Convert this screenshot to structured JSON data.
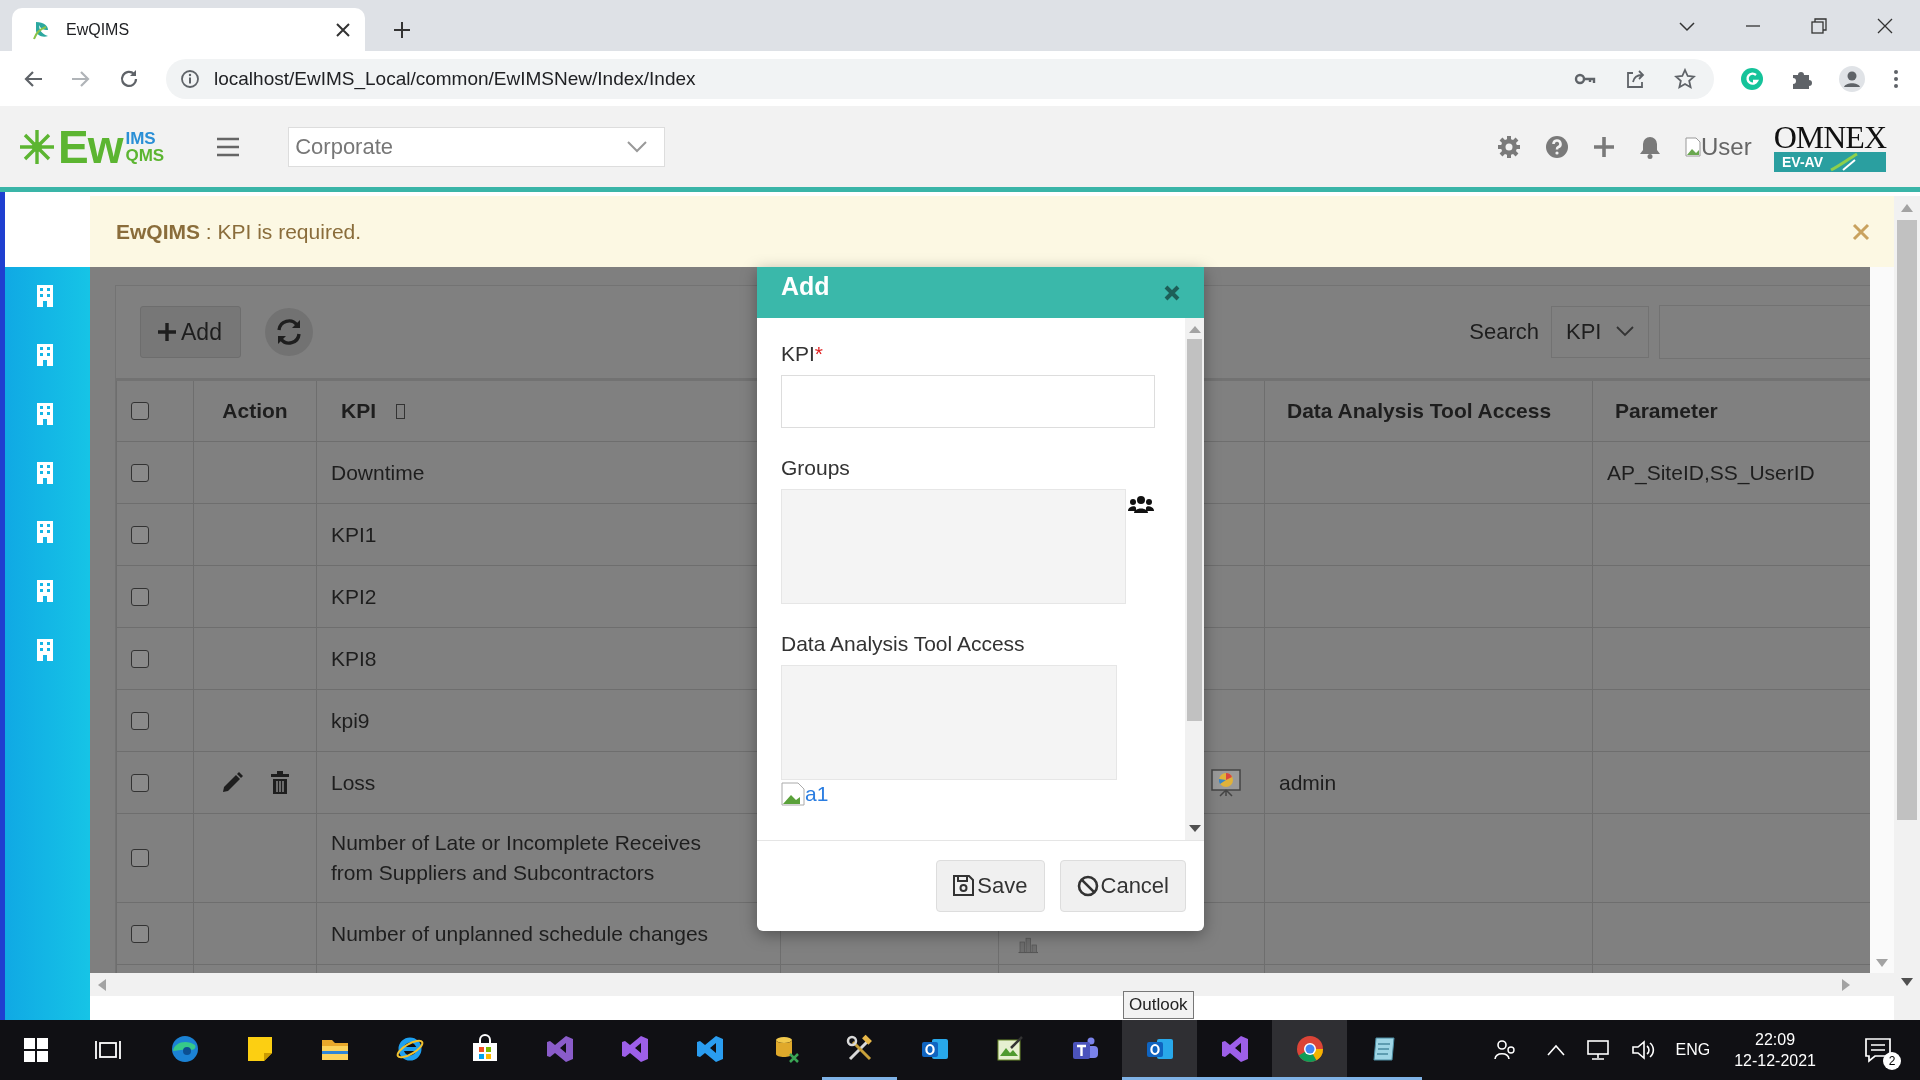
{
  "browser": {
    "tab_title": "EwQIMS",
    "url": "localhost/EwIMS_Local/common/EwIMSNew/Index/Index"
  },
  "header": {
    "logo_main": "Ew",
    "logo_top": "IMS",
    "logo_bottom": "QMS",
    "site": "Corporate",
    "user_alt": "User",
    "brand": "OMNEX",
    "brand_tag": "EV-AV"
  },
  "sidebar": {
    "items": [
      {
        "kind": "building"
      },
      {
        "kind": "building"
      },
      {
        "kind": "building"
      },
      {
        "kind": "building"
      },
      {
        "kind": "building"
      },
      {
        "kind": "building"
      },
      {
        "kind": "building"
      }
    ]
  },
  "alert": {
    "message": "**EwQIMS** : KPI is required."
  },
  "toolbar": {
    "add_label": "Add",
    "search_label": "Search",
    "search_by": "KPI"
  },
  "table": {
    "header_checked": false,
    "columns": [
      "Action",
      "KPI",
      "Data Analysis Tool Access",
      "Parameter"
    ],
    "rows": [
      {
        "checked": false,
        "editable": false,
        "kpi": "Downtime",
        "parameter": "AP_SiteID,SS_UserID"
      },
      {
        "checked": false,
        "editable": false,
        "kpi": "KPI1"
      },
      {
        "checked": false,
        "editable": false,
        "kpi": "KPI2"
      },
      {
        "checked": false,
        "editable": false,
        "kpi": "KPI8"
      },
      {
        "checked": false,
        "editable": false,
        "kpi": "kpi9"
      },
      {
        "checked": false,
        "editable": true,
        "kpi": "Loss",
        "kind": "presentation",
        "data_analysis": "admin"
      },
      {
        "checked": false,
        "editable": false,
        "kpi": "Number of Late or Incomplete Receives from Suppliers and Subcontractors"
      },
      {
        "checked": false,
        "editable": false,
        "kpi": "Number of unplanned schedule changes",
        "kind": "bars"
      }
    ]
  },
  "dialog": {
    "title": "Add",
    "fields": [
      {
        "kind": "text",
        "label": "KPI",
        "required_mark": "*"
      },
      {
        "kind": "picker",
        "label": "Groups"
      },
      {
        "kind": "list",
        "label": "Data Analysis Tool Access"
      }
    ],
    "image_alt": "a1",
    "buttons": [
      {
        "kind": "save",
        "label": "Save"
      },
      {
        "kind": "cancel",
        "label": "Cancel"
      }
    ]
  },
  "taskbar": {
    "apps": [
      {
        "kind": "edge",
        "running": false,
        "highlighted": false
      },
      {
        "kind": "notes",
        "running": false,
        "highlighted": false
      },
      {
        "kind": "explorer",
        "running": false,
        "highlighted": false
      },
      {
        "kind": "ie",
        "running": false,
        "highlighted": false
      },
      {
        "kind": "store",
        "running": false,
        "highlighted": false
      },
      {
        "kind": "vsold",
        "running": false,
        "highlighted": false
      },
      {
        "kind": "vs",
        "running": false,
        "highlighted": false
      },
      {
        "kind": "vscode",
        "running": false,
        "highlighted": false
      },
      {
        "kind": "db",
        "running": false,
        "highlighted": false
      },
      {
        "kind": "tools",
        "running": true,
        "highlighted": false
      },
      {
        "kind": "outlook",
        "running": false,
        "highlighted": false
      },
      {
        "kind": "paint",
        "running": false,
        "highlighted": false
      },
      {
        "kind": "teams",
        "running": false,
        "highlighted": false
      },
      {
        "kind": "outlook",
        "running": true,
        "highlighted": true
      },
      {
        "kind": "vs",
        "running": true,
        "highlighted": false
      },
      {
        "kind": "chrome",
        "running": true,
        "highlighted": true
      },
      {
        "kind": "notepad",
        "running": true,
        "highlighted": false
      }
    ],
    "tooltip": "Outlook",
    "language": "ENG",
    "time": "22:09",
    "date": "12-12-2021",
    "notification_count": "2"
  }
}
